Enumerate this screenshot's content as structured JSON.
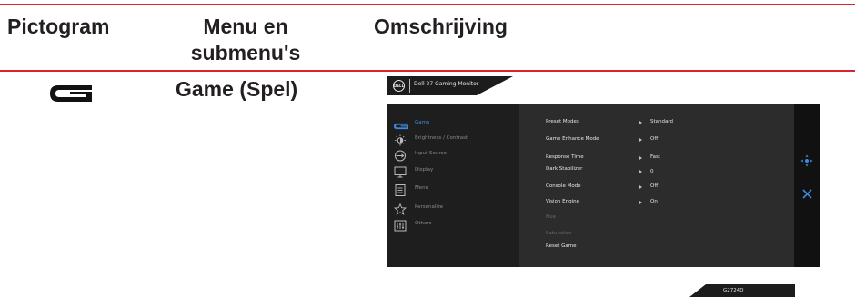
{
  "table": {
    "headers": {
      "icon": "Pictogram",
      "menu_line1": "Menu en",
      "menu_line2": "submenu's",
      "description": "Omschrijving"
    },
    "row": {
      "label": "Game (Spel)",
      "icon": "game-g-icon"
    }
  },
  "osd": {
    "logo_text": "DELL",
    "title": "Dell 27 Gaming Monitor",
    "nav_items": [
      {
        "label": "Game",
        "icon": "game-icon",
        "active": true
      },
      {
        "label": "Brightness / Contrast",
        "icon": "brightness-icon",
        "active": false
      },
      {
        "label": "Input Source",
        "icon": "input-source-icon",
        "active": false
      },
      {
        "label": "Display",
        "icon": "display-icon",
        "active": false
      },
      {
        "label": "Menu",
        "icon": "menu-icon",
        "active": false
      },
      {
        "label": "Personalize",
        "icon": "star-icon",
        "active": false
      },
      {
        "label": "Others",
        "icon": "others-icon",
        "active": false
      }
    ],
    "settings": [
      {
        "label": "Preset Modes",
        "value": "Standard",
        "enabled": true
      },
      {
        "label": "Game Enhance Mode",
        "value": "Off",
        "enabled": true
      },
      {
        "label": "Response Time",
        "value": "Fast",
        "enabled": true
      },
      {
        "label": "Dark Stabilizer",
        "value": "0",
        "enabled": true
      },
      {
        "label": "Console Mode",
        "value": "Off",
        "enabled": true
      },
      {
        "label": "Vision Engine",
        "value": "On",
        "enabled": true
      },
      {
        "label": "Hue",
        "value": "",
        "enabled": false
      },
      {
        "label": "Saturation",
        "value": "",
        "enabled": false
      },
      {
        "label": "Reset Game",
        "value": "",
        "enabled": true
      }
    ],
    "side_controls": [
      "navigate-icon",
      "close-icon"
    ],
    "model": "G2724D"
  },
  "colors": {
    "rule": "#d9262c",
    "accent": "#3d8be0",
    "osd_dark": "#1e1e1e",
    "osd_mid": "#2c2c2c"
  }
}
